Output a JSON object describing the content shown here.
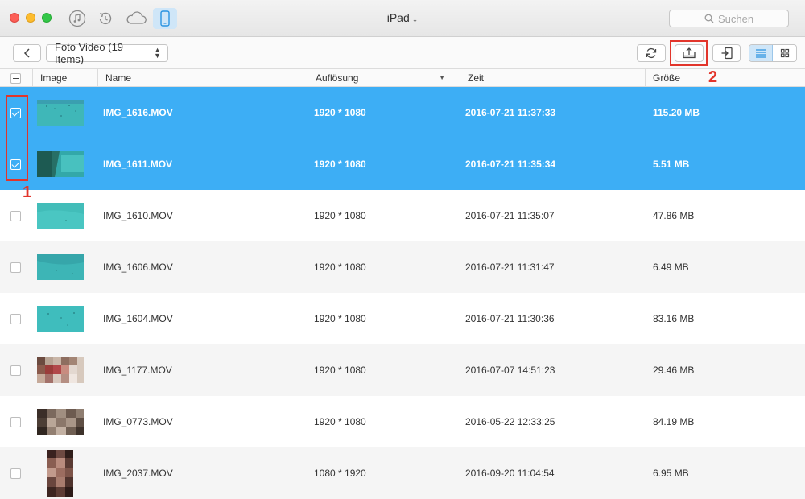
{
  "window": {
    "device_title": "iPad",
    "search_placeholder": "Suchen",
    "toolbar_icons": [
      "music-icon",
      "history-icon",
      "cloud-icon",
      "device-icon"
    ]
  },
  "toolbar": {
    "folder_select": "Foto Video (19 Items)",
    "annotation_1": "1",
    "annotation_2": "2"
  },
  "table": {
    "headers": {
      "image": "Image",
      "name": "Name",
      "resolution": "Auflösung",
      "time": "Zeit",
      "size": "Größe"
    },
    "rows": [
      {
        "name": "IMG_1616.MOV",
        "resolution": "1920 * 1080",
        "time": "2016-07-21 11:37:33",
        "size": "115.20 MB",
        "selected": true
      },
      {
        "name": "IMG_1611.MOV",
        "resolution": "1920 * 1080",
        "time": "2016-07-21 11:35:34",
        "size": "5.51 MB",
        "selected": true
      },
      {
        "name": "IMG_1610.MOV",
        "resolution": "1920 * 1080",
        "time": "2016-07-21 11:35:07",
        "size": "47.86 MB",
        "selected": false
      },
      {
        "name": "IMG_1606.MOV",
        "resolution": "1920 * 1080",
        "time": "2016-07-21 11:31:47",
        "size": "6.49 MB",
        "selected": false
      },
      {
        "name": "IMG_1604.MOV",
        "resolution": "1920 * 1080",
        "time": "2016-07-21 11:30:36",
        "size": "83.16 MB",
        "selected": false
      },
      {
        "name": "IMG_1177.MOV",
        "resolution": "1920 * 1080",
        "time": "2016-07-07 14:51:23",
        "size": "29.46 MB",
        "selected": false
      },
      {
        "name": "IMG_0773.MOV",
        "resolution": "1920 * 1080",
        "time": "2016-05-22 12:33:25",
        "size": "84.19 MB",
        "selected": false
      },
      {
        "name": "IMG_2037.MOV",
        "resolution": "1080 * 1920",
        "time": "2016-09-20 11:04:54",
        "size": "6.95 MB",
        "selected": false
      }
    ]
  },
  "colors": {
    "selection": "#3daef5",
    "annotation": "#e2352b",
    "active_toggle": "#cfe6f8"
  }
}
